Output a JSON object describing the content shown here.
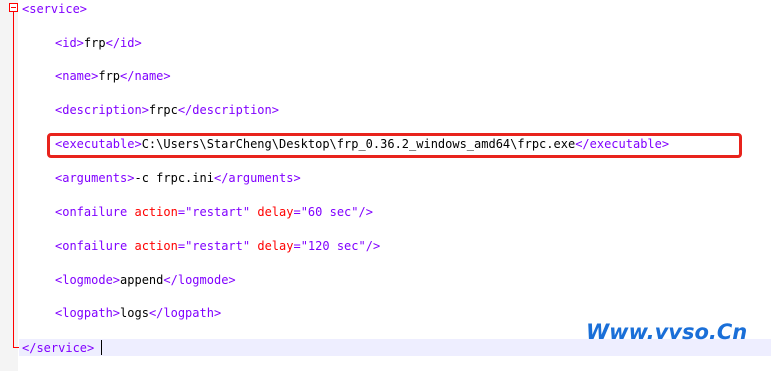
{
  "editor": {
    "lines": [
      {
        "kind": "open",
        "tag": "service"
      },
      {
        "kind": "elem",
        "tag": "id",
        "text": "frp"
      },
      {
        "kind": "elem",
        "tag": "name",
        "text": "frp"
      },
      {
        "kind": "elem",
        "tag": "description",
        "text": "frpc"
      },
      {
        "kind": "elem",
        "tag": "executable",
        "text": "C:\\Users\\StarCheng\\Desktop\\frp_0.36.2_windows_amd64\\frpc.exe"
      },
      {
        "kind": "elem",
        "tag": "arguments",
        "text": "-c frpc.ini"
      },
      {
        "kind": "empty",
        "tag": "onfailure",
        "attrs": [
          {
            "name": "action",
            "value": "\"restart\""
          },
          {
            "name": "delay",
            "value": "\"60 sec\""
          }
        ]
      },
      {
        "kind": "empty",
        "tag": "onfailure",
        "attrs": [
          {
            "name": "action",
            "value": "\"restart\""
          },
          {
            "name": "delay",
            "value": "\"120 sec\""
          }
        ]
      },
      {
        "kind": "elem",
        "tag": "logmode",
        "text": "append"
      },
      {
        "kind": "elem",
        "tag": "logpath",
        "text": "logs"
      },
      {
        "kind": "close",
        "tag": "service"
      }
    ],
    "highlighted_line": 4
  },
  "watermark": "Www.vvso.Cn",
  "colors": {
    "tag": "#8000ff",
    "attribute": "#ff0000",
    "highlight_box": "#e8231c",
    "watermark": "#1a6fd8"
  }
}
